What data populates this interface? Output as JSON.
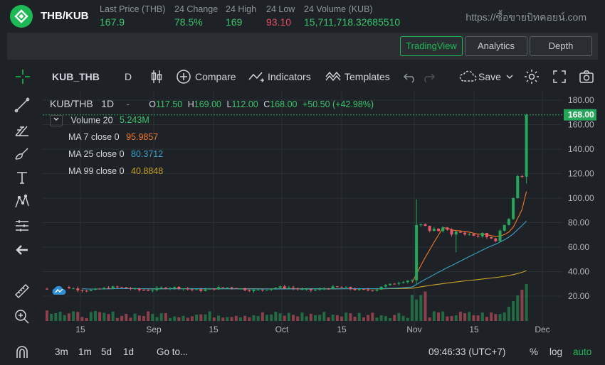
{
  "header": {
    "pair": "THB/KUB",
    "site": "https://ซื้อขายบิทคอยน์.com",
    "stats": [
      {
        "label": "Last Price (THB)",
        "value": "167.9",
        "color": "green"
      },
      {
        "label": "24 Change",
        "value": "78.5%",
        "color": "green"
      },
      {
        "label": "24 High",
        "value": "169",
        "color": "green"
      },
      {
        "label": "24 Low",
        "value": "93.10",
        "color": "red"
      },
      {
        "label": "24 Volume (KUB)",
        "value": "15,711,718.32685510",
        "color": "green"
      }
    ]
  },
  "tabs": {
    "tradingview": "TradingView",
    "analytics": "Analytics",
    "depth": "Depth"
  },
  "toolbar": {
    "symbol": "KUB_THB",
    "interval": "D",
    "compare": "Compare",
    "indicators": "Indicators",
    "templates": "Templates",
    "save": "Save"
  },
  "legend": {
    "symbol": "KUB/THB",
    "interval": "1D",
    "dash": "-",
    "o_label": "O",
    "o": "117.50",
    "h_label": "H",
    "h": "169.00",
    "l_label": "L",
    "l": "112.00",
    "c_label": "C",
    "c": "168.00",
    "change": "+50.50 (+42.98%)",
    "volume_label": "Volume 20",
    "volume_value": "5.243M",
    "ma7_label": "MA 7 close 0",
    "ma7_value": "95.9857",
    "ma25_label": "MA 25 close 0",
    "ma25_value": "80.3712",
    "ma99_label": "MA 99 close 0",
    "ma99_value": "40.8848"
  },
  "colors": {
    "up": "#26a65b",
    "down": "#e85a6b",
    "ma7": "#f27a2a",
    "ma25": "#3aa0c8",
    "ma99": "#c9a227",
    "accent": "#1db954",
    "red": "#e84e62"
  },
  "chart_data": {
    "type": "candlestick",
    "symbol": "KUB/THB",
    "interval": "1D",
    "ylim": [
      10,
      185
    ],
    "y_ticks": [
      "180.00",
      "160.00",
      "140.00",
      "120.00",
      "100.00",
      "80.00",
      "60.00",
      "40.00",
      "20.00"
    ],
    "x_ticks": [
      "15",
      "Sep",
      "15",
      "Oct",
      "15",
      "Nov",
      "15",
      "Dec"
    ],
    "last_price": "168.00",
    "phases": [
      {
        "from": "Aug 10",
        "to": "Oct 25",
        "range": [
          23,
          29
        ],
        "note": "flat"
      },
      {
        "from": "Oct 25",
        "to": "Nov 1",
        "range": [
          29,
          35
        ]
      },
      {
        "from": "Nov 2",
        "to": "Nov 3",
        "range": [
          30,
          100
        ],
        "note": "spike"
      },
      {
        "from": "Nov 3",
        "to": "Nov 24",
        "range": [
          58,
          84
        ]
      },
      {
        "from": "Nov 24",
        "to": "Nov 28",
        "range": [
          70,
          169
        ],
        "note": "rally"
      }
    ]
  },
  "bottom": {
    "r3m": "3m",
    "r1m": "1m",
    "r5d": "5d",
    "r1d": "1d",
    "goto": "Go to...",
    "time": "09:46:33 (UTC+7)",
    "pct": "%",
    "log": "log",
    "auto": "auto"
  }
}
